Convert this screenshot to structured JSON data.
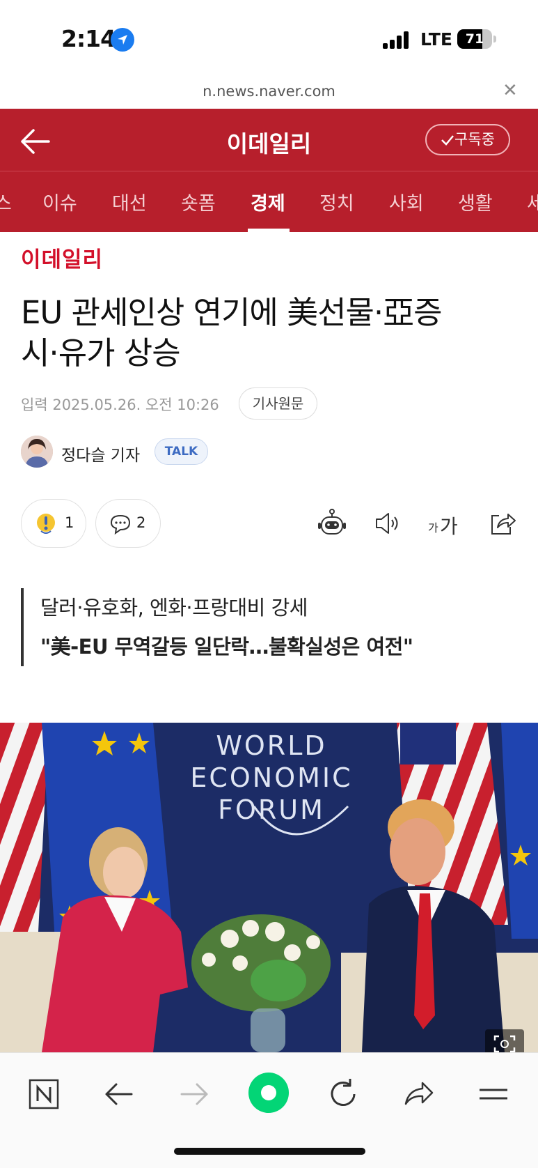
{
  "status": {
    "time": "2:14",
    "network": "LTE",
    "battery": "71",
    "battery_level": 0.71
  },
  "url_bar": {
    "domain": "n.news.naver.com",
    "close_icon": "close-icon"
  },
  "header": {
    "back_icon": "arrow-left-icon",
    "title": "이데일리",
    "subscribe_label": "구독중",
    "color": "#b71f2c"
  },
  "tabs": [
    {
      "label": "스"
    },
    {
      "label": "이슈"
    },
    {
      "label": "대선"
    },
    {
      "label": "숏폼"
    },
    {
      "label": "경제"
    },
    {
      "label": "정치"
    },
    {
      "label": "사회"
    },
    {
      "label": "생활"
    },
    {
      "label": "세"
    }
  ],
  "active_tab": "경제",
  "article": {
    "brand": "이데일리",
    "brand_color": "#d3102a",
    "headline_line1": "EU 관세인상 연기에 美선물·亞증",
    "headline_line2": "시·유가 상승",
    "input_label": "입력",
    "date": "2025.05.26. 오전 10:26",
    "original_link": "기사원문",
    "reporter_name": "정다슬 기자",
    "talk_label": "TALK",
    "reaction_count": "1",
    "comment_count": "2",
    "font_size_label_small": "가",
    "font_size_label_large": "가",
    "summary_line1": "달러·유호화, 엔화·프랑대비 강세",
    "summary_line2": "\"美-EU 무역갈등 일단락…불확실성은 여전\""
  },
  "photo": {
    "wef_line1": "WORLD",
    "wef_line2": "ECONOMIC",
    "wef_line3": "FORUM",
    "expand_icon": "expand-icon"
  },
  "toolbar": {
    "icons": [
      "naver-home-icon",
      "back-arrow-icon",
      "forward-arrow-icon",
      "green-dot-icon",
      "refresh-icon",
      "share-icon",
      "menu-icon"
    ]
  }
}
